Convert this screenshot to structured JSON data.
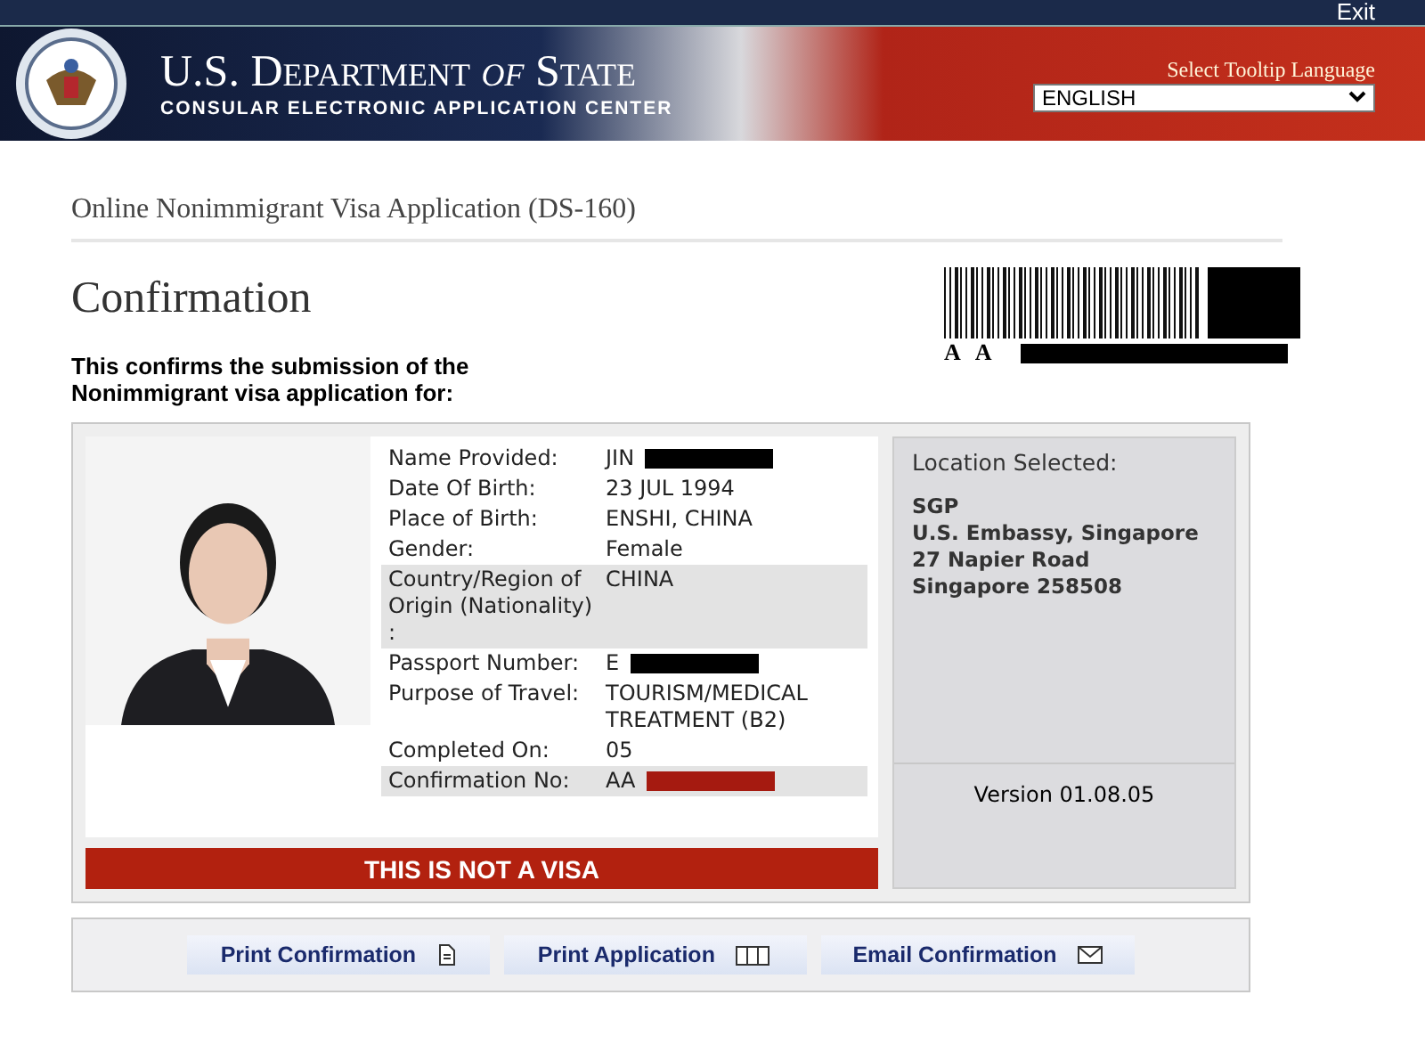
{
  "header": {
    "exit": "Exit",
    "title_main": "U.S. Department",
    "title_of": "of",
    "title_state": "State",
    "subtitle": "CONSULAR ELECTRONIC APPLICATION CENTER",
    "language_label": "Select Tooltip Language",
    "language": "ENGLISH"
  },
  "page_title": "Online Nonimmigrant Visa Application (DS-160)",
  "heading": "Confirmation",
  "barcode": {
    "letters": [
      "A",
      "A"
    ],
    "redacted": true
  },
  "intro": "This confirms the submission of the Nonimmigrant visa application for:",
  "fields": [
    {
      "label": "Name Provided:",
      "value": "JIN",
      "redacted": true,
      "color": "#000000",
      "shaded": false
    },
    {
      "label": "Date Of Birth:",
      "value": "23 JUL 1994",
      "redacted": false,
      "shaded": false
    },
    {
      "label": "Place of Birth:",
      "value": "ENSHI, CHINA",
      "redacted": false,
      "shaded": false
    },
    {
      "label": "Gender:",
      "value": "Female",
      "redacted": false,
      "shaded": false
    },
    {
      "label": "Country/Region of Origin (Nationality) :",
      "value": "CHINA",
      "redacted": false,
      "shaded": true
    },
    {
      "label": "Passport Number:",
      "value": "E",
      "redacted": true,
      "color": "#000000",
      "shaded": false
    },
    {
      "label": "Purpose of Travel:",
      "value": "TOURISM/MEDICAL TREATMENT (B2)",
      "redacted": false,
      "shaded": false
    },
    {
      "label": "Completed On:",
      "value": "05",
      "redacted": false,
      "shaded": false
    },
    {
      "label": "Confirmation No:",
      "value": "AA",
      "redacted": true,
      "color": "#a51a10",
      "shaded": true
    }
  ],
  "location": {
    "label": "Location Selected:",
    "lines": [
      "SGP",
      "U.S. Embassy, Singapore",
      "27 Napier Road",
      "Singapore 258508"
    ]
  },
  "version": "Version 01.08.05",
  "banner": "THIS IS NOT A VISA",
  "buttons": [
    {
      "label": "Print Confirmation",
      "kind": "document"
    },
    {
      "label": "Print Application",
      "kind": "pages"
    },
    {
      "label": "Email Confirmation",
      "kind": "envelope"
    }
  ]
}
